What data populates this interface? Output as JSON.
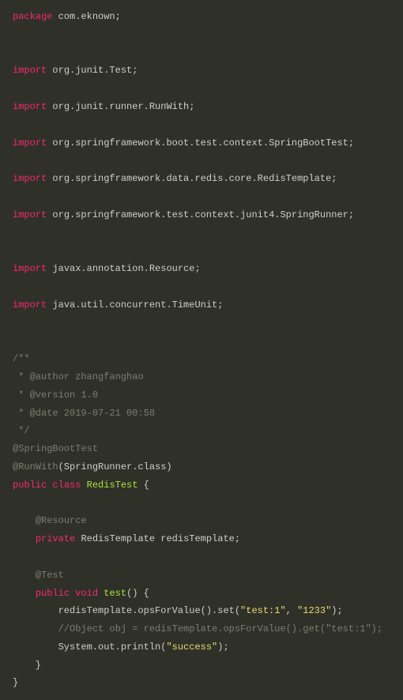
{
  "code": {
    "package_kw": "package",
    "package_name": "com.eknown",
    "import_kw": "import",
    "imp1": "org.junit.Test",
    "imp2": "org.junit.runner.RunWith",
    "imp3": "org.springframework.boot.test.context.SpringBootTest",
    "imp4": "org.springframework.data.redis.core.RedisTemplate",
    "imp5": "org.springframework.test.context.junit4.SpringRunner",
    "imp6": "javax.annotation.Resource",
    "imp7": "java.util.concurrent.TimeUnit",
    "c_open": "/**",
    "c_author": " * @author zhangfanghao",
    "c_version": " * @version 1.0",
    "c_date": " * @date 2019-07-21 00:58",
    "c_close": " */",
    "ann_sbt": "@SpringBootTest",
    "ann_runwith": "@RunWith",
    "ann_runwith_arg": "(SpringRunner.class)",
    "public_kw": "public",
    "class_kw": "class",
    "class_name": "RedisTest",
    "ann_resource": "@Resource",
    "private_kw": "private",
    "rt_type": "RedisTemplate",
    "rt_var": "redisTemplate",
    "ann_test": "@Test",
    "void_kw": "void",
    "method_name": "test",
    "line_set_pre": "redisTemplate.opsForValue().set(",
    "str_key": "\"test:1\"",
    "comma": ", ",
    "str_val": "\"1233\"",
    "line_set_post": ");",
    "line_comment": "//Object obj = redisTemplate.opsForValue().get(\"test:1\");",
    "line_print_pre": "System.out.println(",
    "str_success": "\"success\"",
    "line_print_post": ");"
  }
}
